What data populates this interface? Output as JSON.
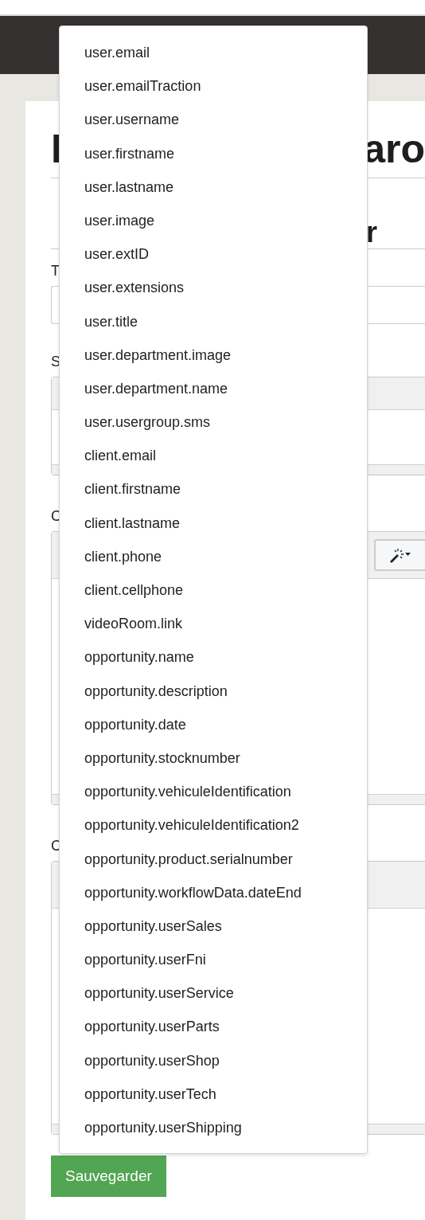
{
  "page": {
    "heading": [
      "I",
      "aro"
    ],
    "subheading": [
      "r"
    ],
    "fields": [
      {
        "kind": "input",
        "label": "T"
      },
      {
        "kind": "editor",
        "label": "S",
        "magic_button": false
      },
      {
        "kind": "tall_editor",
        "label": "C",
        "magic_button": true
      },
      {
        "kind": "tall_editor",
        "label": "C",
        "magic_button": false
      }
    ]
  },
  "dropdown": {
    "items": [
      "user.email",
      "user.emailTraction",
      "user.username",
      "user.firstname",
      "user.lastname",
      "user.image",
      "user.extID",
      "user.extensions",
      "user.title",
      "user.department.image",
      "user.department.name",
      "user.usergroup.sms",
      "client.email",
      "client.firstname",
      "client.lastname",
      "client.phone",
      "client.cellphone",
      "videoRoom.link",
      "opportunity.name",
      "opportunity.description",
      "opportunity.date",
      "opportunity.stocknumber",
      "opportunity.vehiculeIdentification",
      "opportunity.vehiculeIdentification2",
      "opportunity.product.serialnumber",
      "opportunity.workflowData.dateEnd",
      "opportunity.userSales",
      "opportunity.userFni",
      "opportunity.userService",
      "opportunity.userParts",
      "opportunity.userShop",
      "opportunity.userTech",
      "opportunity.userShipping"
    ]
  },
  "save_button": "Sauvegarder"
}
